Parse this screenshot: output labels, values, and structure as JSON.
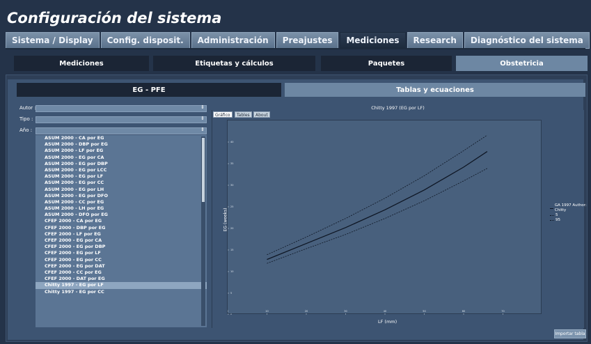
{
  "window_title": "Configuración del sistema",
  "main_tabs": [
    {
      "label": "Sistema / Display"
    },
    {
      "label": "Config. disposit."
    },
    {
      "label": "Administración"
    },
    {
      "label": "Preajustes"
    },
    {
      "label": "Mediciones"
    },
    {
      "label": "Research"
    },
    {
      "label": "Diagnóstico del sistema"
    }
  ],
  "sub_tabs": [
    {
      "label": "Mediciones"
    },
    {
      "label": "Etiquetas y cálculos"
    },
    {
      "label": "Paquetes"
    },
    {
      "label": "Obstetricia"
    }
  ],
  "section_tabs": [
    {
      "label": "EG - PFE"
    },
    {
      "label": "Tablas y ecuaciones"
    }
  ],
  "filters": {
    "autor_label": "Autor :",
    "tipo_label": "Tipo :",
    "ano_label": "Año :",
    "autor_value": "",
    "tipo_value": "",
    "ano_value": ""
  },
  "table_list": [
    "ASUM 2000 - CA por EG",
    "ASUM 2000 - DBP por EG",
    "ASUM 2000 - LF por EG",
    "ASUM 2000 - EG por CA",
    "ASUM 2000 - EG por DBP",
    "ASUM 2000 - EG por LCC",
    "ASUM 2000 - EG por LF",
    "ASUM 2000 - EG por CC",
    "ASUM 2000 - EG por LH",
    "ASUM 2000 - EG por DFO",
    "ASUM 2000 - CC por EG",
    "ASUM 2000 - LH por EG",
    "ASUM 2000 - DFO por EG",
    "CFEF 2000 - CA por EG",
    "CFEF 2000 - DBP por EG",
    "CFEF 2000 - LF por EG",
    "CFEF 2000 - EG por CA",
    "CFEF 2000 - EG por DBP",
    "CFEF 2000 - EG por LF",
    "CFEF 2000 - EG por CC",
    "CFEF 2000 - EG por DAT",
    "CFEF 2000 - CC por EG",
    "CFEF 2000 - DAT por EG",
    "Chitty 1997 - EG por LF",
    "Chitty 1997 - EG por CC"
  ],
  "selected_index": 23,
  "graph_tabs": [
    {
      "label": "Gráfico"
    },
    {
      "label": "Tables"
    },
    {
      "label": "About"
    }
  ],
  "import_button": "Importar tabla",
  "colors": {
    "accent_active_tab": "#1d2b3d",
    "subtab_active": "#6d87a3",
    "plot_bg": "#48607d"
  },
  "chart_data": {
    "type": "line",
    "title": "Chitty 1997 (EG por LF)",
    "xlabel": "LF (mm)",
    "ylabel": "EG (weeks)",
    "xlim": [
      0,
      80
    ],
    "ylim": [
      0,
      45
    ],
    "x_ticks": [
      "0",
      "10",
      "20",
      "30",
      "40",
      "50",
      "60",
      "70"
    ],
    "y_ticks": [
      "0",
      "5",
      "10",
      "15",
      "20",
      "25",
      "30",
      "35",
      "40"
    ],
    "grid": false,
    "legend_position": "right",
    "series": [
      {
        "name": "GA 1997 Author: Chitty",
        "style": "solid",
        "x": [
          10,
          20,
          30,
          40,
          50,
          60,
          66
        ],
        "y": [
          12.8,
          16.5,
          20.2,
          24.3,
          28.9,
          34.2,
          37.8
        ]
      },
      {
        "name": "5",
        "style": "dotted",
        "x": [
          10,
          20,
          30,
          40,
          50,
          60,
          66
        ],
        "y": [
          11.9,
          15.3,
          18.6,
          22.3,
          26.4,
          31.0,
          33.9
        ]
      },
      {
        "name": "95",
        "style": "dotted",
        "x": [
          10,
          20,
          30,
          40,
          50,
          60,
          66
        ],
        "y": [
          13.9,
          18.0,
          22.3,
          27.0,
          32.2,
          38.0,
          41.6
        ]
      }
    ]
  }
}
